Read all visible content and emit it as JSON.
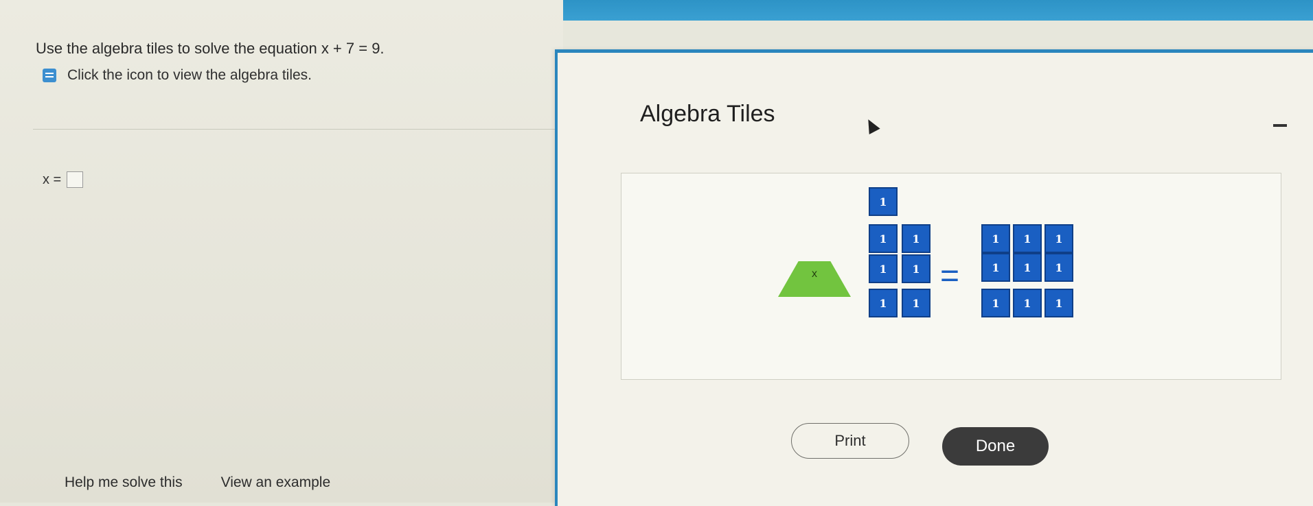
{
  "question": {
    "text": "Use the algebra tiles to solve the equation x + 7 = 9."
  },
  "instruction": {
    "icon": "document-icon",
    "text": "Click the icon to view the algebra tiles."
  },
  "answer": {
    "label": "x =",
    "value": ""
  },
  "bottom_links": {
    "help": "Help me solve this",
    "example": "View an example"
  },
  "popup": {
    "title": "Algebra Tiles",
    "x_tile_label": "x",
    "unit_tile_label": "1",
    "left_unit_count": 7,
    "right_unit_count": 9,
    "equals": "=",
    "print_label": "Print",
    "done_label": "Done"
  },
  "colors": {
    "x_tile": "#72c43f",
    "unit_tile": "#1a5fc2",
    "accent": "#2a86bd"
  }
}
